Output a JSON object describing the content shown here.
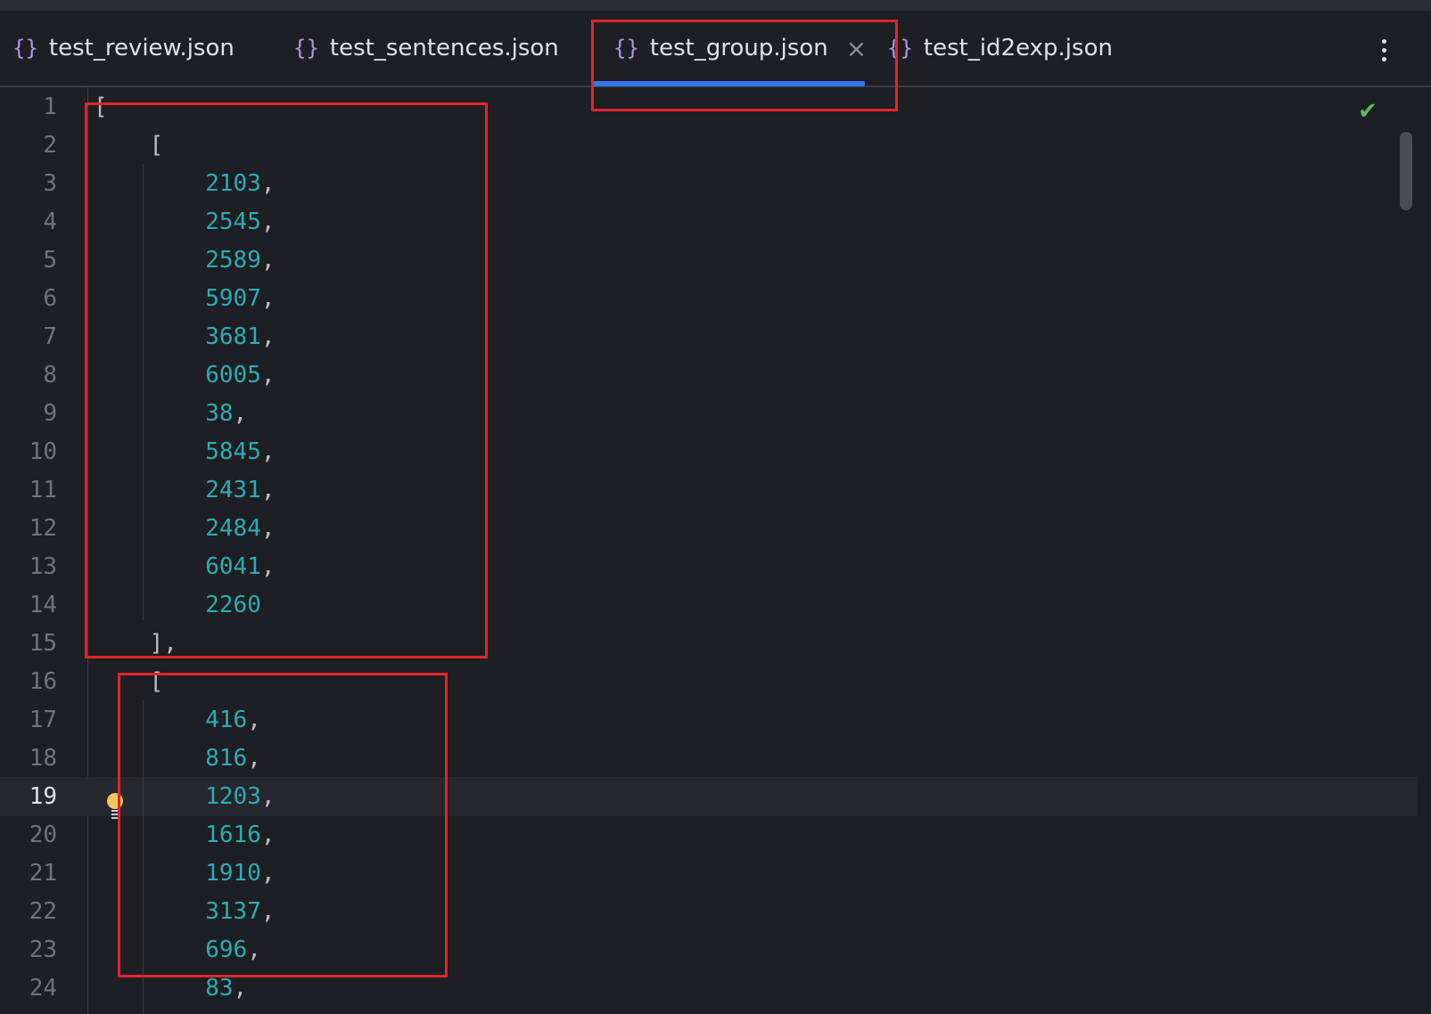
{
  "tabs": [
    {
      "icon": "{}",
      "label": "test_review.json",
      "active": false
    },
    {
      "icon": "{}",
      "label": "test_sentences.json",
      "active": false
    },
    {
      "icon": "{}",
      "label": "test_group.json",
      "active": true,
      "close": "×"
    },
    {
      "icon": "{}",
      "label": "test_id2exp.json",
      "active": false
    }
  ],
  "editor": {
    "current_line": 19,
    "inspection_status": "✔",
    "lines": [
      {
        "n": "1",
        "text": "["
      },
      {
        "n": "2",
        "text": "    ["
      },
      {
        "n": "3",
        "value": "2103",
        "suffix": ","
      },
      {
        "n": "4",
        "value": "2545",
        "suffix": ","
      },
      {
        "n": "5",
        "value": "2589",
        "suffix": ","
      },
      {
        "n": "6",
        "value": "5907",
        "suffix": ","
      },
      {
        "n": "7",
        "value": "3681",
        "suffix": ","
      },
      {
        "n": "8",
        "value": "6005",
        "suffix": ","
      },
      {
        "n": "9",
        "value": "38",
        "suffix": ","
      },
      {
        "n": "10",
        "value": "5845",
        "suffix": ","
      },
      {
        "n": "11",
        "value": "2431",
        "suffix": ","
      },
      {
        "n": "12",
        "value": "2484",
        "suffix": ","
      },
      {
        "n": "13",
        "value": "6041",
        "suffix": ","
      },
      {
        "n": "14",
        "value": "2260",
        "suffix": ""
      },
      {
        "n": "15",
        "text": "    ],"
      },
      {
        "n": "16",
        "text": "    ["
      },
      {
        "n": "17",
        "value": "416",
        "suffix": ","
      },
      {
        "n": "18",
        "value": "816",
        "suffix": ","
      },
      {
        "n": "19",
        "value": "1203",
        "suffix": ","
      },
      {
        "n": "20",
        "value": "1616",
        "suffix": ","
      },
      {
        "n": "21",
        "value": "1910",
        "suffix": ","
      },
      {
        "n": "22",
        "value": "3137",
        "suffix": ","
      },
      {
        "n": "23",
        "value": "696",
        "suffix": ","
      },
      {
        "n": "24",
        "value": "83",
        "suffix": ","
      }
    ]
  },
  "colors": {
    "background": "#1e1f22",
    "number": "#2aacb8",
    "tab_underline": "#3574f0",
    "annotation_box": "#e0242e",
    "bulb": "#f2c55c",
    "check": "#5fb865"
  }
}
